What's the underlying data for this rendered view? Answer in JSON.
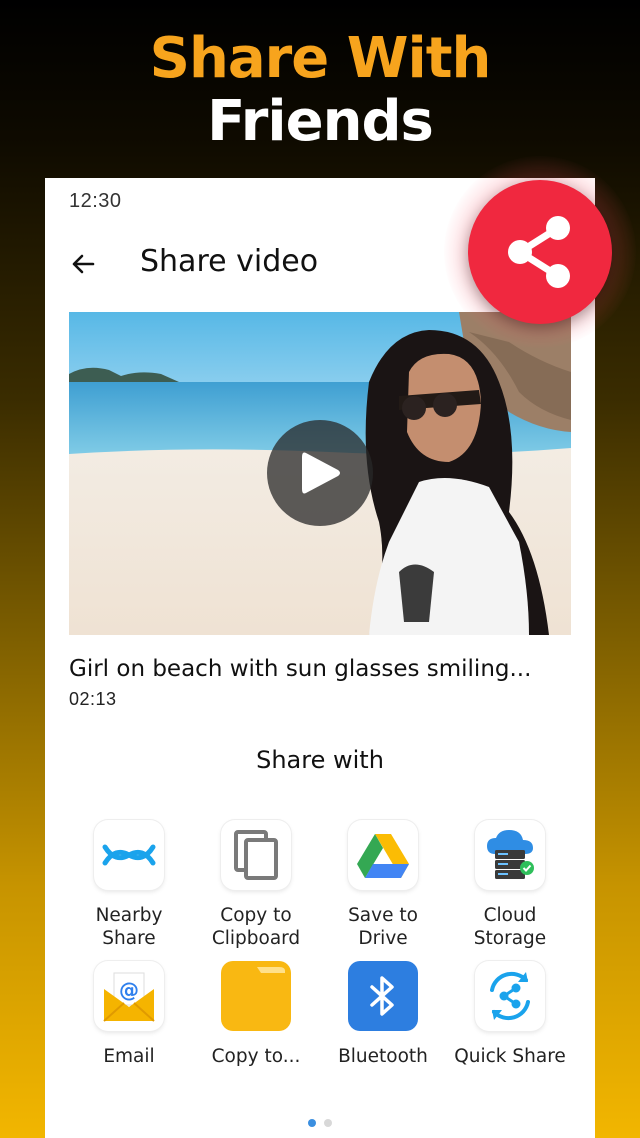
{
  "headline": {
    "line1": "Share With",
    "line2": "Friends"
  },
  "status_bar": {
    "time": "12:30"
  },
  "header": {
    "title": "Share video",
    "back_icon": "arrow-left-icon"
  },
  "video": {
    "title": "Girl on beach with sun glasses smiling...",
    "duration": "02:13",
    "play_icon": "play-icon"
  },
  "share": {
    "heading": "Share with",
    "apps": [
      {
        "line1": "Nearby",
        "line2": "Share",
        "icon": "nearby-share-icon"
      },
      {
        "line1": "Copy to",
        "line2": "Clipboard",
        "icon": "clipboard-icon"
      },
      {
        "line1": "Save to",
        "line2": "Drive",
        "icon": "drive-icon"
      },
      {
        "line1": "Cloud",
        "line2": "Storage",
        "icon": "cloud-storage-icon"
      },
      {
        "line1": "Email",
        "line2": "",
        "icon": "email-icon"
      },
      {
        "line1": "Copy to...",
        "line2": "",
        "icon": "folder-icon"
      },
      {
        "line1": "Bluetooth",
        "line2": "",
        "icon": "bluetooth-icon"
      },
      {
        "line1": "Quick Share",
        "line2": "",
        "icon": "quick-share-icon"
      }
    ]
  },
  "pagination": {
    "pages": 2,
    "current": 1
  },
  "fab": {
    "icon": "share-icon",
    "color": "#f0283f"
  },
  "colors": {
    "headline_accent": "#f7a41d",
    "headline_secondary": "#ffffff",
    "background_bottom": "#f2b600",
    "dot_active": "#3b8fe0"
  }
}
